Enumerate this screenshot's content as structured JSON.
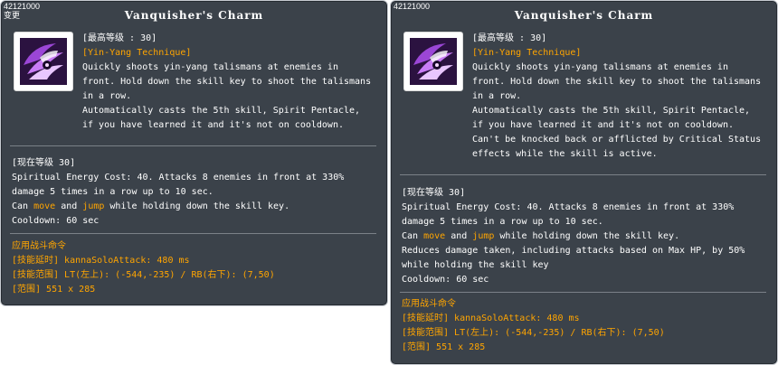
{
  "tooltips": [
    {
      "skill_id": "42121000",
      "changed_tag": "变更",
      "title": "Vanquisher's Charm",
      "icon": "yin-yang-talisman-skill-icon",
      "max_level": "[最高等级 : 30]",
      "skill_type": "[Yin-Yang Technique]",
      "description": [
        "Quickly shoots yin-yang talismans at enemies in",
        "front. Hold down the skill key to shoot the talismans",
        "in a row.",
        "Automatically casts the 5th skill, Spirit Pentacle,",
        "if you have learned it and it's not on cooldown."
      ],
      "current_level": "[现在等级 30]",
      "effect": {
        "line1": "Spiritual Energy Cost: 40. Attacks 8 enemies in front at 330%",
        "line2": "damage 5 times in a row up to 10 sec.",
        "line3_a": "Can ",
        "line3_move": "move",
        "line3_b": " and ",
        "line3_jump": "jump",
        "line3_c": " while holding down the skill key.",
        "extra": [],
        "cooldown": "Cooldown: 60 sec"
      },
      "command_header": "应用战斗命令",
      "delay": "[技能延时] kannaSoloAttack: 480 ms",
      "range": "[技能范围] LT(左上): (-544,-235) / RB(右下): (7,50)",
      "area": "[范围] 551 x 285"
    },
    {
      "skill_id": "42121000",
      "changed_tag": "",
      "title": "Vanquisher's Charm",
      "icon": "yin-yang-talisman-skill-icon",
      "max_level": "[最高等级 : 30]",
      "skill_type": "[Yin-Yang Technique]",
      "description": [
        "Quickly shoots yin-yang talismans at enemies in",
        "front. Hold down the skill key to shoot the talismans",
        "in a row.",
        "Automatically casts the 5th skill, Spirit Pentacle,",
        "if you have learned it and it's not on cooldown.",
        "Can't be knocked back or afflicted by Critical Status",
        "effects while the skill is active."
      ],
      "current_level": "[现在等级 30]",
      "effect": {
        "line1": "Spiritual Energy Cost: 40. Attacks 8 enemies in front at 330%",
        "line2": "damage 5 times in a row up to 10 sec.",
        "line3_a": "Can ",
        "line3_move": "move",
        "line3_b": " and ",
        "line3_jump": "jump",
        "line3_c": " while holding down the skill key.",
        "extra": [
          "Reduces damage taken, including attacks based on Max HP, by 50%",
          "while holding the skill key"
        ],
        "cooldown": "Cooldown: 60 sec"
      },
      "command_header": "应用战斗命令",
      "delay": "[技能延时] kannaSoloAttack: 480 ms",
      "range": "[技能范围] LT(左上): (-544,-235) / RB(右下): (7,50)",
      "area": "[范围] 551 x 285"
    }
  ]
}
